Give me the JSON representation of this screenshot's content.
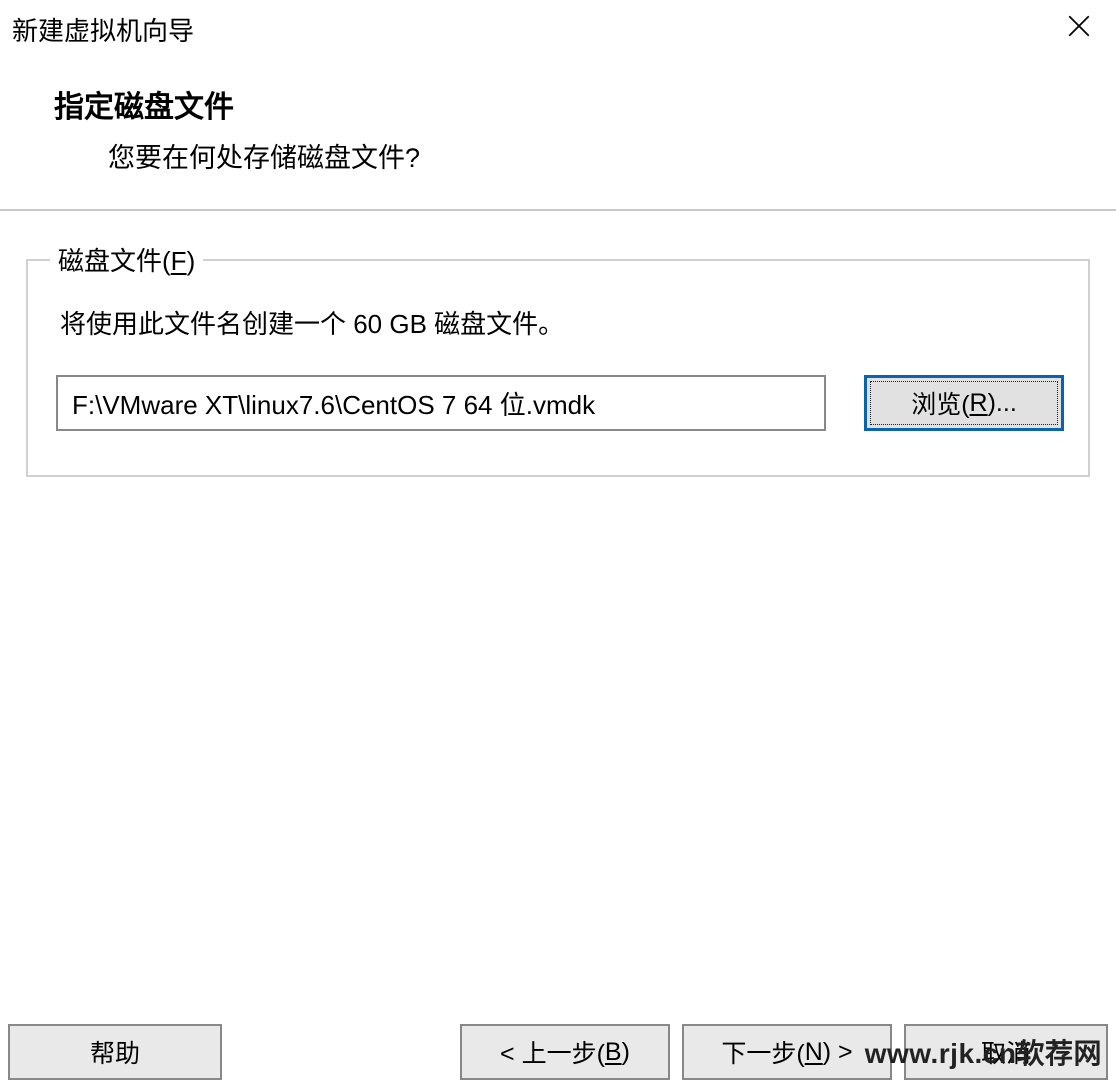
{
  "window": {
    "title": "新建虚拟机向导"
  },
  "header": {
    "title": "指定磁盘文件",
    "subtitle": "您要在何处存储磁盘文件?"
  },
  "group": {
    "legend_pre": "磁盘文件(",
    "legend_key": "F",
    "legend_post": ")",
    "description": "将使用此文件名创建一个 60 GB 磁盘文件。",
    "file_value": "F:\\VMware XT\\linux7.6\\CentOS 7 64 位.vmdk",
    "browse_pre": "浏览(",
    "browse_key": "R",
    "browse_post": ")..."
  },
  "footer": {
    "help": "帮助",
    "back_pre": "< 上一步(",
    "back_key": "B",
    "back_post": ")",
    "next_pre": "下一步(",
    "next_key": "N",
    "next_post": ") >",
    "cancel": "取消"
  },
  "watermark": "www.rjk.cn软荐网"
}
